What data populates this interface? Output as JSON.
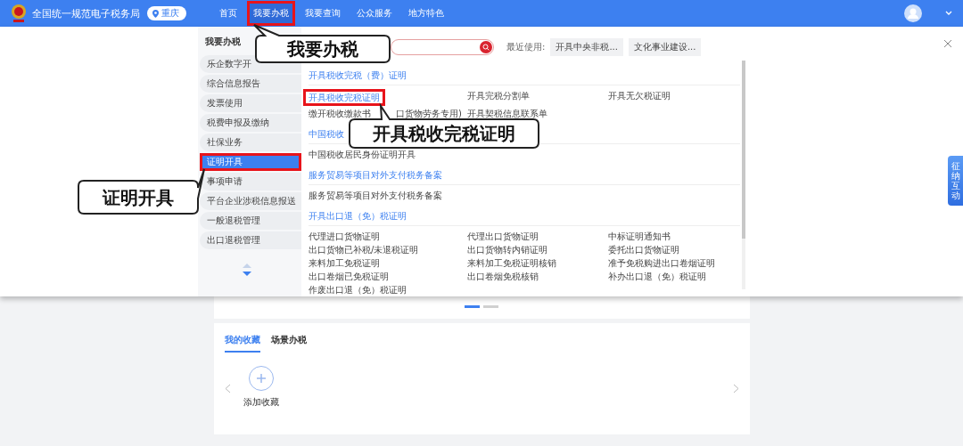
{
  "header": {
    "title": "全国统一规范电子税务局",
    "location": "重庆",
    "nav": [
      {
        "label": "首页",
        "selected": false,
        "highlighted": false
      },
      {
        "label": "我要办税",
        "selected": true,
        "highlighted": true
      },
      {
        "label": "我要查询",
        "selected": false,
        "highlighted": false
      },
      {
        "label": "公众服务",
        "selected": false,
        "highlighted": false
      },
      {
        "label": "地方特色",
        "selected": false,
        "highlighted": false
      }
    ]
  },
  "menu": {
    "title": "我要办税",
    "categories": [
      {
        "label": "乐企数字开",
        "selected": false,
        "highlighted": false
      },
      {
        "label": "综合信息报告",
        "selected": false,
        "highlighted": false
      },
      {
        "label": "发票使用",
        "selected": false,
        "highlighted": false
      },
      {
        "label": "税费申报及缴纳",
        "selected": false,
        "highlighted": false
      },
      {
        "label": "社保业务",
        "selected": false,
        "highlighted": false
      },
      {
        "label": "证明开具",
        "selected": true,
        "highlighted": true
      },
      {
        "label": "事项申请",
        "selected": false,
        "highlighted": false
      },
      {
        "label": "平台企业涉税信息报送",
        "selected": false,
        "highlighted": false
      },
      {
        "label": "一般退税管理",
        "selected": false,
        "highlighted": false
      },
      {
        "label": "出口退税管理",
        "selected": false,
        "highlighted": false
      }
    ],
    "recent": {
      "label": "最近使用:",
      "items": [
        "开具中央非税...",
        "文化事业建设..."
      ]
    },
    "sections": [
      {
        "heading": "开具税收完税（费）证明",
        "items": [
          {
            "label": "开具税收完税证明",
            "highlighted": true
          },
          {
            "label": "开具完税分割单",
            "highlighted": false
          },
          {
            "label": "开具无欠税证明",
            "highlighted": false
          },
          {
            "label": "缴开税收缴款书",
            "tail": "口货物劳务专用)",
            "highlighted": false
          },
          {
            "label": "开具契税信息联系单",
            "highlighted": false
          }
        ]
      },
      {
        "heading": "中国税收",
        "items": [
          {
            "label": "中国税收居民身份证明开具",
            "highlighted": false
          }
        ]
      },
      {
        "heading": "服务贸易等项目对外支付税务备案",
        "items": [
          {
            "label": "服务贸易等项目对外支付税务备案",
            "highlighted": false
          }
        ]
      },
      {
        "heading": "开具出口退（免）税证明",
        "items": [
          {
            "label": "代理进口货物证明",
            "highlighted": false
          },
          {
            "label": "代理出口货物证明",
            "highlighted": false
          },
          {
            "label": "中标证明通知书",
            "highlighted": false
          },
          {
            "label": "出口货物已补税/未退税证明",
            "highlighted": false
          },
          {
            "label": "出口货物转内销证明",
            "highlighted": false
          },
          {
            "label": "委托出口货物证明",
            "highlighted": false
          },
          {
            "label": "来料加工免税证明",
            "highlighted": false
          },
          {
            "label": "来料加工免税证明核销",
            "highlighted": false
          },
          {
            "label": "准予免税购进出口卷烟证明",
            "highlighted": false
          },
          {
            "label": "出口卷烟已免税证明",
            "highlighted": false
          },
          {
            "label": "出口卷烟免税核销",
            "highlighted": false
          },
          {
            "label": "补办出口退（免）税证明",
            "highlighted": false
          },
          {
            "label": "作废出口退（免）税证明",
            "highlighted": false
          }
        ]
      }
    ]
  },
  "side_tab": "征纳互动",
  "carousel": {
    "pages": [
      {
        "selected": true
      },
      {
        "selected": false
      }
    ]
  },
  "favorites": {
    "tabs": [
      {
        "label": "我的收藏",
        "selected": true
      },
      {
        "label": "场景办税",
        "selected": false
      }
    ],
    "add_label": "添加收藏"
  },
  "annotations": [
    {
      "text": "我要办税"
    },
    {
      "text": "开具税收完税证明"
    },
    {
      "text": "证明开具"
    }
  ]
}
